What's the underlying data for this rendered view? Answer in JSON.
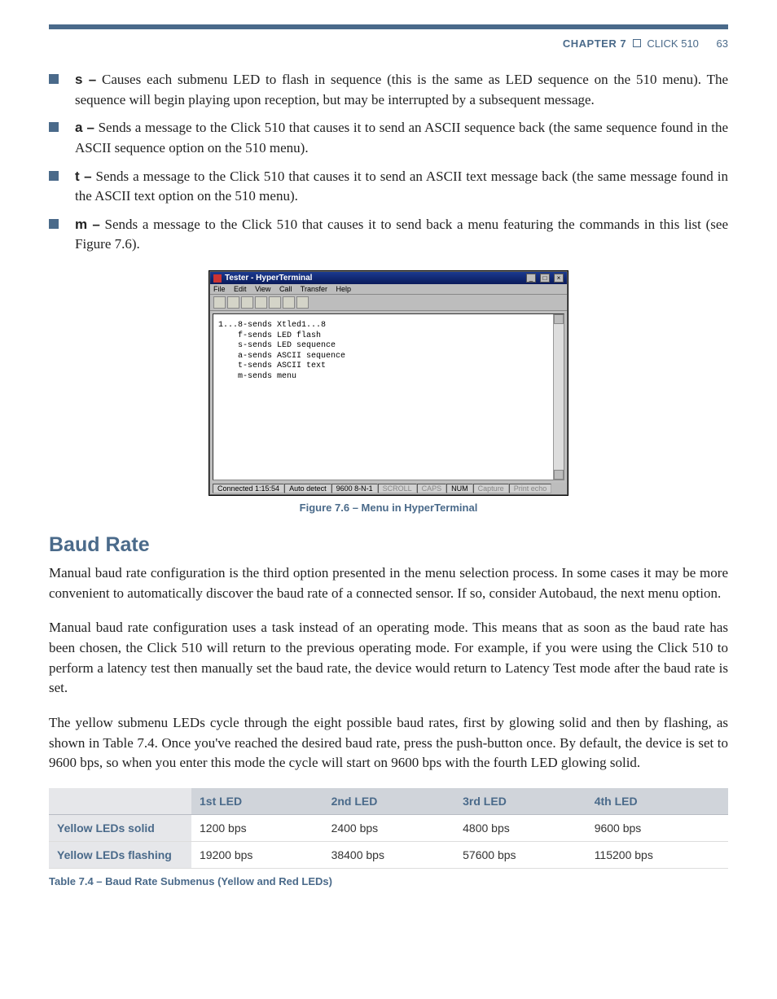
{
  "header": {
    "chapter": "CHAPTER 7",
    "title": "CLICK 510",
    "page": "63"
  },
  "commands": [
    {
      "key": "s –",
      "text": " Causes each submenu LED to flash in sequence (this is the same as LED sequence on the 510 menu). The sequence will begin playing upon reception, but may be interrupted by a subsequent message."
    },
    {
      "key": "a –",
      "text": " Sends a message to the Click 510 that causes it to send an ASCII sequence back (the same sequence found in the ASCII sequence option on the 510 menu)."
    },
    {
      "key": "t –",
      "text": " Sends a message to the Click 510 that causes it to send an ASCII text message back (the same message found in the ASCII text option on the 510 menu)."
    },
    {
      "key": "m –",
      "text": " Sends a message to the Click 510 that causes it to send back a menu featuring the commands in this list (see Figure 7.6)."
    }
  ],
  "hyper": {
    "title": "Tester - HyperTerminal",
    "menu": [
      "File",
      "Edit",
      "View",
      "Call",
      "Transfer",
      "Help"
    ],
    "terminal_lines": [
      "1...8-sends Xtled1...8",
      "    f-sends LED flash",
      "    s-sends LED sequence",
      "    a-sends ASCII sequence",
      "    t-sends ASCII text",
      "    m-sends menu"
    ],
    "status": [
      "Connected 1:15:54",
      "Auto detect",
      "9600 8-N-1",
      "SCROLL",
      "CAPS",
      "NUM",
      "Capture",
      "Print echo"
    ]
  },
  "figure_caption": "Figure 7.6 – Menu in HyperTerminal",
  "section_heading": "Baud Rate",
  "paragraphs": [
    "Manual baud rate configuration is the third option presented in the menu selection process. In some cases it may be more convenient to automatically discover the baud rate of a connected sensor. If so, consider Autobaud, the next menu option.",
    "Manual baud rate configuration uses a task instead of an operating mode. This means that as soon as the baud rate has been chosen, the Click 510 will return to the previous operating mode. For example, if you were using the Click 510 to perform a latency test then manually set the baud rate, the device would return to Latency Test mode after the baud rate is set.",
    "The yellow submenu LEDs cycle through the eight possible baud rates, first by glowing solid and then by flashing, as shown in Table 7.4. Once you've reached the desired baud rate, press the push-button once. By default, the device is set to 9600 bps, so when you enter this mode the cycle will start on 9600 bps with the fourth LED glowing solid."
  ],
  "table": {
    "headers": [
      "",
      "1st LED",
      "2nd LED",
      "3rd LED",
      "4th LED"
    ],
    "rows": [
      {
        "label": "Yellow LEDs solid",
        "cells": [
          "1200 bps",
          "2400 bps",
          "4800 bps",
          "9600 bps"
        ]
      },
      {
        "label": "Yellow LEDs flashing",
        "cells": [
          "19200 bps",
          "38400 bps",
          "57600 bps",
          "115200 bps"
        ]
      }
    ]
  },
  "table_caption": "Table 7.4 – Baud Rate Submenus (Yellow and Red LEDs)"
}
